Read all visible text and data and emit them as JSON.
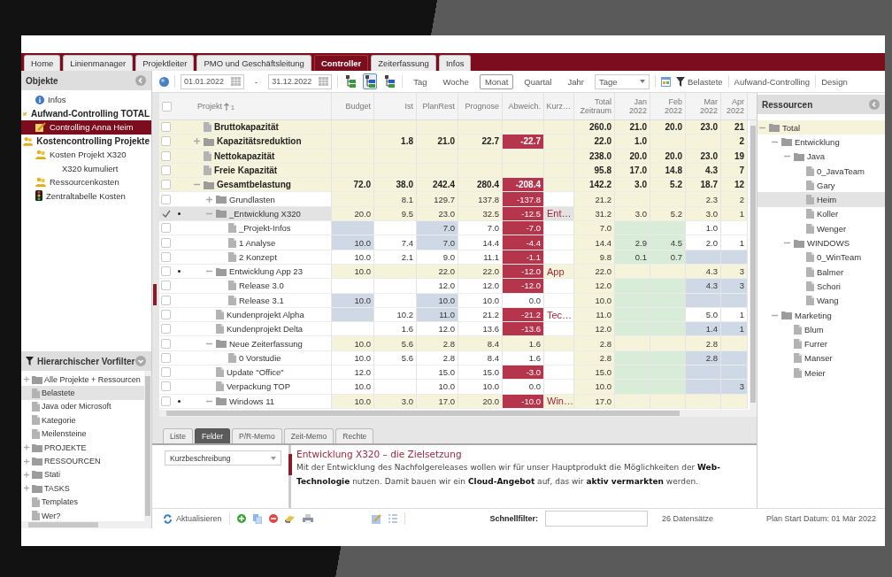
{
  "tabs": [
    {
      "label": "Home",
      "selected": false
    },
    {
      "label": "Linienmanager",
      "selected": false
    },
    {
      "label": "Projektleiter",
      "selected": false
    },
    {
      "label": "PMO und Geschäftsleitung",
      "selected": false
    },
    {
      "label": "Controller",
      "selected": true
    },
    {
      "label": "Zeiterfassung",
      "selected": false
    },
    {
      "label": "Infos",
      "selected": false
    }
  ],
  "objects_panel": {
    "title": "Objekte",
    "items": [
      {
        "label": "Infos",
        "kind": "info",
        "bold": false,
        "selected": false
      },
      {
        "label": "Aufwand-Controlling TOTAL",
        "kind": "note",
        "bold": true,
        "selected": false,
        "children": [
          {
            "label": "Controlling Anna Heim",
            "kind": "note",
            "bold": false,
            "selected": true
          }
        ]
      },
      {
        "label": "Kostencontrolling Projekte",
        "kind": "people",
        "bold": true,
        "selected": false,
        "children": [
          {
            "label": "Kosten Projekt X320",
            "kind": "people",
            "bold": false,
            "selected": false,
            "children": [
              {
                "label": "X320 kumuliert",
                "bold": false,
                "selected": false
              }
            ]
          },
          {
            "label": "Ressourcenkosten",
            "kind": "people",
            "bold": false,
            "selected": false
          },
          {
            "label": "Zentraltabelle Kosten",
            "kind": "traffic",
            "bold": false,
            "selected": false
          }
        ]
      }
    ]
  },
  "prefilter_panel": {
    "title": "Hierarchischer Vorfilter",
    "items": [
      {
        "label": "Alle Projekte + Ressourcen",
        "kind": "folder",
        "expanded": false,
        "selected": false
      },
      {
        "label": "Belastete",
        "kind": "file",
        "selected": true
      },
      {
        "label": "Java oder Microsoft",
        "kind": "file",
        "selected": false
      },
      {
        "label": "Kategorie",
        "kind": "file",
        "selected": false
      },
      {
        "label": "Meilensteine",
        "kind": "file",
        "selected": false
      },
      {
        "label": "PROJEKTE",
        "kind": "folder",
        "expanded": false,
        "selected": false
      },
      {
        "label": "RESSOURCEN",
        "kind": "folder",
        "expanded": false,
        "selected": false
      },
      {
        "label": "Stati",
        "kind": "folder",
        "expanded": false,
        "selected": false
      },
      {
        "label": "TASKS",
        "kind": "folder",
        "expanded": false,
        "selected": false
      },
      {
        "label": "Templates",
        "kind": "file",
        "selected": false
      },
      {
        "label": "Wer?",
        "kind": "file",
        "selected": false
      }
    ]
  },
  "toolbar": {
    "date_from": "01.01.2022",
    "separator": "-",
    "date_to": "31.12.2022",
    "view_buttons": [
      {
        "selected": false
      },
      {
        "selected": true
      },
      {
        "selected": false
      }
    ],
    "periods": [
      {
        "label": "Tag",
        "selected": false
      },
      {
        "label": "Woche",
        "selected": false
      },
      {
        "label": "Monat",
        "selected": true
      },
      {
        "label": "Quartal",
        "selected": false
      },
      {
        "label": "Jahr",
        "selected": false
      }
    ],
    "unit_select": "Tage",
    "filter_label": "Belastete",
    "links": [
      "Aufwand-Controlling",
      "Design"
    ]
  },
  "table": {
    "select_all_checked": false,
    "tree_column": {
      "label": "Projekt",
      "sort_rank": "1"
    },
    "columns": [
      {
        "label": "Budget"
      },
      {
        "label": "Ist"
      },
      {
        "label": "PlanRest"
      },
      {
        "label": "Prognose"
      },
      {
        "label": "Abweich."
      },
      {
        "label": "Kurz…"
      },
      {
        "label": "Total Zeitraum"
      },
      {
        "label": "Jan 2022"
      },
      {
        "label": "Feb 2022"
      },
      {
        "label": "Mar 2022"
      },
      {
        "label": "Apr 2022"
      }
    ],
    "rows": [
      {
        "name": "Bruttokapazität",
        "kind": "file",
        "bold": true,
        "checked": false,
        "marked": false,
        "selected": false,
        "cells": [
          {
            "kind": "total"
          },
          {
            "kind": "total"
          },
          {
            "kind": "total"
          },
          {
            "kind": "total"
          },
          {
            "kind": "total"
          },
          {
            "kind": "total"
          },
          {
            "kind": "total",
            "text": "260.0"
          },
          {
            "kind": "total",
            "text": "21.0"
          },
          {
            "kind": "total",
            "text": "20.0"
          },
          {
            "kind": "total",
            "text": "23.0"
          },
          {
            "kind": "total",
            "text": "21"
          }
        ]
      },
      {
        "name": "Kapazitätsreduktion",
        "kind": "folder",
        "expanded": false,
        "bold": true,
        "checked": false,
        "marked": false,
        "selected": false,
        "cells": [
          {
            "kind": "total"
          },
          {
            "kind": "total",
            "text": "1.8"
          },
          {
            "kind": "total",
            "text": "21.0"
          },
          {
            "kind": "total",
            "text": "22.7"
          },
          {
            "kind": "deviation",
            "text": "-22.7"
          },
          {
            "kind": "total"
          },
          {
            "kind": "total",
            "text": "22.0"
          },
          {
            "kind": "total",
            "text": "1.0"
          },
          {
            "kind": "total"
          },
          {
            "kind": "total"
          },
          {
            "kind": "total",
            "text": "2"
          }
        ]
      },
      {
        "name": "Nettokapazität",
        "kind": "file",
        "bold": true,
        "checked": false,
        "marked": false,
        "selected": false,
        "cells": [
          {
            "kind": "total"
          },
          {
            "kind": "total"
          },
          {
            "kind": "total"
          },
          {
            "kind": "total"
          },
          {
            "kind": "total"
          },
          {
            "kind": "total"
          },
          {
            "kind": "total",
            "text": "238.0"
          },
          {
            "kind": "total",
            "text": "20.0"
          },
          {
            "kind": "total",
            "text": "20.0"
          },
          {
            "kind": "total",
            "text": "23.0"
          },
          {
            "kind": "total",
            "text": "19"
          }
        ]
      },
      {
        "name": "Freie Kapazität",
        "kind": "file",
        "bold": true,
        "checked": false,
        "marked": false,
        "selected": false,
        "cells": [
          {
            "kind": "total"
          },
          {
            "kind": "total"
          },
          {
            "kind": "total"
          },
          {
            "kind": "total"
          },
          {
            "kind": "total"
          },
          {
            "kind": "total"
          },
          {
            "kind": "total",
            "text": "95.8"
          },
          {
            "kind": "total",
            "text": "17.0"
          },
          {
            "kind": "total",
            "text": "14.8"
          },
          {
            "kind": "total",
            "text": "4.3"
          },
          {
            "kind": "total",
            "text": "7"
          }
        ]
      },
      {
        "name": "Gesamtbelastung",
        "kind": "folder",
        "expanded": true,
        "bold": true,
        "checked": false,
        "marked": false,
        "selected": false,
        "cells": [
          {
            "kind": "total",
            "text": "72.0"
          },
          {
            "kind": "total",
            "text": "38.0"
          },
          {
            "kind": "total",
            "text": "242.4"
          },
          {
            "kind": "total",
            "text": "280.4"
          },
          {
            "kind": "deviation",
            "text": "-208.4"
          },
          {
            "kind": "total"
          },
          {
            "kind": "total",
            "text": "142.2"
          },
          {
            "kind": "total",
            "text": "3.0"
          },
          {
            "kind": "total",
            "text": "5.2"
          },
          {
            "kind": "total",
            "text": "18.7"
          },
          {
            "kind": "total",
            "text": "12"
          }
        ],
        "children": [
          {
            "name": "Grundlasten",
            "kind": "folder",
            "expanded": false,
            "bold": false,
            "checked": false,
            "marked": false,
            "selected": false,
            "cells": [
              {
                "kind": "total"
              },
              {
                "kind": "total",
                "text": "8.1"
              },
              {
                "kind": "total",
                "text": "129.7"
              },
              {
                "kind": "total",
                "text": "137.8"
              },
              {
                "kind": "deviation",
                "text": "-137.8"
              },
              {
                "kind": "plain"
              },
              {
                "kind": "total",
                "text": "21.2"
              },
              {
                "kind": "total"
              },
              {
                "kind": "total"
              },
              {
                "kind": "total",
                "text": "2.3"
              },
              {
                "kind": "total",
                "text": "2"
              }
            ]
          },
          {
            "name": "_Entwicklung X320",
            "kind": "folder",
            "expanded": true,
            "bold": false,
            "checked": true,
            "marked": true,
            "selected": true,
            "cells": [
              {
                "kind": "total",
                "text": "20.0"
              },
              {
                "kind": "total",
                "text": "9.5"
              },
              {
                "kind": "total",
                "text": "23.0"
              },
              {
                "kind": "total",
                "text": "32.5"
              },
              {
                "kind": "deviation",
                "text": "-12.5"
              },
              {
                "kind": "current",
                "text": "Ent…"
              },
              {
                "kind": "total",
                "text": "31.2"
              },
              {
                "kind": "total",
                "text": "3.0"
              },
              {
                "kind": "total",
                "text": "5.2"
              },
              {
                "kind": "total",
                "text": "3.0"
              },
              {
                "kind": "total",
                "text": "1"
              }
            ],
            "children": [
              {
                "name": "_Projekt-Infos",
                "kind": "file",
                "bold": false,
                "checked": false,
                "marked": false,
                "selected": false,
                "cells": [
                  {
                    "kind": "plan"
                  },
                  {
                    "kind": "plain"
                  },
                  {
                    "kind": "plan",
                    "text": "7.0"
                  },
                  {
                    "kind": "plain",
                    "text": "7.0"
                  },
                  {
                    "kind": "deviation",
                    "text": "-7.0"
                  },
                  {
                    "kind": "plain"
                  },
                  {
                    "kind": "total",
                    "text": "7.0"
                  },
                  {
                    "kind": "booked"
                  },
                  {
                    "kind": "booked"
                  },
                  {
                    "kind": "plain",
                    "text": "1.0"
                  },
                  {
                    "kind": "plain"
                  }
                ]
              },
              {
                "name": "1 Analyse",
                "kind": "file",
                "bold": false,
                "checked": false,
                "marked": false,
                "selected": false,
                "cells": [
                  {
                    "kind": "plan",
                    "text": "10.0"
                  },
                  {
                    "kind": "plain",
                    "text": "7.4"
                  },
                  {
                    "kind": "plan",
                    "text": "7.0"
                  },
                  {
                    "kind": "plain",
                    "text": "14.4"
                  },
                  {
                    "kind": "deviation",
                    "text": "-4.4"
                  },
                  {
                    "kind": "plain"
                  },
                  {
                    "kind": "total",
                    "text": "14.4"
                  },
                  {
                    "kind": "booked",
                    "text": "2.9"
                  },
                  {
                    "kind": "booked",
                    "text": "4.5"
                  },
                  {
                    "kind": "plain",
                    "text": "2.0"
                  },
                  {
                    "kind": "plain",
                    "text": "1"
                  }
                ]
              },
              {
                "name": "2 Konzept",
                "kind": "file",
                "bold": false,
                "checked": false,
                "marked": false,
                "selected": false,
                "cells": [
                  {
                    "kind": "plain",
                    "text": "10.0"
                  },
                  {
                    "kind": "plain",
                    "text": "2.1"
                  },
                  {
                    "kind": "plain",
                    "text": "9.0"
                  },
                  {
                    "kind": "plain",
                    "text": "11.1"
                  },
                  {
                    "kind": "deviation",
                    "text": "-1.1"
                  },
                  {
                    "kind": "plain"
                  },
                  {
                    "kind": "total",
                    "text": "9.8"
                  },
                  {
                    "kind": "booked",
                    "text": "0.1"
                  },
                  {
                    "kind": "booked",
                    "text": "0.7"
                  },
                  {
                    "kind": "plan"
                  },
                  {
                    "kind": "plan"
                  }
                ]
              }
            ]
          },
          {
            "name": "Entwicklung App 23",
            "kind": "folder",
            "expanded": true,
            "bold": false,
            "checked": false,
            "marked": true,
            "selected": false,
            "cells": [
              {
                "kind": "total",
                "text": "10.0"
              },
              {
                "kind": "total"
              },
              {
                "kind": "total",
                "text": "22.0"
              },
              {
                "kind": "total",
                "text": "22.0"
              },
              {
                "kind": "deviation",
                "text": "-12.0"
              },
              {
                "kind": "total",
                "text": "App"
              },
              {
                "kind": "total",
                "text": "22.0"
              },
              {
                "kind": "total"
              },
              {
                "kind": "total"
              },
              {
                "kind": "total",
                "text": "4.3"
              },
              {
                "kind": "total",
                "text": "3"
              }
            ],
            "children": [
              {
                "name": "Release 3.0",
                "kind": "file",
                "bold": false,
                "checked": false,
                "marked": false,
                "selected": false,
                "cells": [
                  {
                    "kind": "plain"
                  },
                  {
                    "kind": "plain"
                  },
                  {
                    "kind": "plain",
                    "text": "12.0"
                  },
                  {
                    "kind": "plain",
                    "text": "12.0"
                  },
                  {
                    "kind": "deviation",
                    "text": "-12.0"
                  },
                  {
                    "kind": "plain"
                  },
                  {
                    "kind": "total",
                    "text": "12.0"
                  },
                  {
                    "kind": "booked"
                  },
                  {
                    "kind": "booked"
                  },
                  {
                    "kind": "plan",
                    "text": "4.3"
                  },
                  {
                    "kind": "plan",
                    "text": "3"
                  }
                ]
              },
              {
                "name": "Release 3.1",
                "kind": "file",
                "bold": false,
                "checked": false,
                "marked": false,
                "selected": false,
                "cells": [
                  {
                    "kind": "plan",
                    "text": "10.0"
                  },
                  {
                    "kind": "plain"
                  },
                  {
                    "kind": "plan",
                    "text": "10.0"
                  },
                  {
                    "kind": "plain",
                    "text": "10.0"
                  },
                  {
                    "kind": "plain",
                    "text": "0.0"
                  },
                  {
                    "kind": "plain"
                  },
                  {
                    "kind": "total",
                    "text": "10.0"
                  },
                  {
                    "kind": "booked"
                  },
                  {
                    "kind": "booked"
                  },
                  {
                    "kind": "plan"
                  },
                  {
                    "kind": "plan"
                  }
                ]
              }
            ]
          },
          {
            "name": "Kundenprojekt Alpha",
            "kind": "file",
            "bold": false,
            "checked": false,
            "marked": false,
            "selected": false,
            "cells": [
              {
                "kind": "plan"
              },
              {
                "kind": "plain",
                "text": "10.2"
              },
              {
                "kind": "plan",
                "text": "11.0"
              },
              {
                "kind": "plain",
                "text": "21.2"
              },
              {
                "kind": "deviation",
                "text": "-21.2"
              },
              {
                "kind": "plain",
                "text": "Tec…"
              },
              {
                "kind": "total",
                "text": "11.0"
              },
              {
                "kind": "booked"
              },
              {
                "kind": "booked"
              },
              {
                "kind": "plain",
                "text": "5.0"
              },
              {
                "kind": "plain",
                "text": "1"
              }
            ]
          },
          {
            "name": "Kundenprojekt Delta",
            "kind": "file",
            "bold": false,
            "checked": false,
            "marked": false,
            "selected": false,
            "cells": [
              {
                "kind": "plain"
              },
              {
                "kind": "plain",
                "text": "1.6"
              },
              {
                "kind": "plain",
                "text": "12.0"
              },
              {
                "kind": "plain",
                "text": "13.6"
              },
              {
                "kind": "deviation",
                "text": "-13.6"
              },
              {
                "kind": "plain"
              },
              {
                "kind": "total",
                "text": "12.0"
              },
              {
                "kind": "booked"
              },
              {
                "kind": "booked"
              },
              {
                "kind": "plan",
                "text": "1.4"
              },
              {
                "kind": "plan",
                "text": "1"
              }
            ]
          },
          {
            "name": "Neue Zeiterfassung",
            "kind": "folder",
            "expanded": true,
            "bold": false,
            "checked": false,
            "marked": false,
            "selected": false,
            "cells": [
              {
                "kind": "total",
                "text": "10.0"
              },
              {
                "kind": "total",
                "text": "5.6"
              },
              {
                "kind": "total",
                "text": "2.8"
              },
              {
                "kind": "total",
                "text": "8.4"
              },
              {
                "kind": "total",
                "text": "1.6"
              },
              {
                "kind": "total"
              },
              {
                "kind": "total",
                "text": "2.8"
              },
              {
                "kind": "total"
              },
              {
                "kind": "total"
              },
              {
                "kind": "total",
                "text": "2.8"
              },
              {
                "kind": "total"
              }
            ],
            "children": [
              {
                "name": "0 Vorstudie",
                "kind": "file",
                "bold": false,
                "checked": false,
                "marked": false,
                "selected": false,
                "cells": [
                  {
                    "kind": "plain",
                    "text": "10.0"
                  },
                  {
                    "kind": "plain",
                    "text": "5.6"
                  },
                  {
                    "kind": "plain",
                    "text": "2.8"
                  },
                  {
                    "kind": "plain",
                    "text": "8.4"
                  },
                  {
                    "kind": "plain",
                    "text": "1.6"
                  },
                  {
                    "kind": "plain"
                  },
                  {
                    "kind": "total",
                    "text": "2.8"
                  },
                  {
                    "kind": "booked"
                  },
                  {
                    "kind": "booked"
                  },
                  {
                    "kind": "plan",
                    "text": "2.8"
                  },
                  {
                    "kind": "plan"
                  }
                ]
              }
            ]
          },
          {
            "name": "Update \"Office\"",
            "kind": "file",
            "bold": false,
            "checked": false,
            "marked": false,
            "selected": false,
            "cells": [
              {
                "kind": "plain",
                "text": "12.0"
              },
              {
                "kind": "plain"
              },
              {
                "kind": "plain",
                "text": "15.0"
              },
              {
                "kind": "plain",
                "text": "15.0"
              },
              {
                "kind": "deviation",
                "text": "-3.0"
              },
              {
                "kind": "plain"
              },
              {
                "kind": "total",
                "text": "15.0"
              },
              {
                "kind": "booked"
              },
              {
                "kind": "booked"
              },
              {
                "kind": "plan"
              },
              {
                "kind": "plan"
              }
            ]
          },
          {
            "name": "Verpackung TOP",
            "kind": "file",
            "bold": false,
            "checked": false,
            "marked": false,
            "selected": false,
            "cells": [
              {
                "kind": "plain",
                "text": "10.0"
              },
              {
                "kind": "plain"
              },
              {
                "kind": "plain",
                "text": "10.0"
              },
              {
                "kind": "plain",
                "text": "10.0"
              },
              {
                "kind": "plain",
                "text": "0.0"
              },
              {
                "kind": "plain"
              },
              {
                "kind": "total",
                "text": "10.0"
              },
              {
                "kind": "booked"
              },
              {
                "kind": "booked"
              },
              {
                "kind": "plan"
              },
              {
                "kind": "plan",
                "text": "3"
              }
            ]
          },
          {
            "name": "Windows 11",
            "kind": "folder",
            "expanded": true,
            "bold": false,
            "checked": false,
            "marked": true,
            "selected": false,
            "cells": [
              {
                "kind": "total",
                "text": "10.0"
              },
              {
                "kind": "total",
                "text": "3.0"
              },
              {
                "kind": "total",
                "text": "17.0"
              },
              {
                "kind": "total",
                "text": "20.0"
              },
              {
                "kind": "deviation",
                "text": "-10.0"
              },
              {
                "kind": "total",
                "text": "Win…"
              },
              {
                "kind": "total",
                "text": "17.0"
              },
              {
                "kind": "total"
              },
              {
                "kind": "total"
              },
              {
                "kind": "total"
              },
              {
                "kind": "total"
              }
            ]
          }
        ]
      }
    ]
  },
  "detail_tabs": [
    {
      "label": "Liste",
      "selected": false
    },
    {
      "label": "Felder",
      "selected": true
    },
    {
      "label": "P/R-Memo",
      "selected": false
    },
    {
      "label": "Zeit-Memo",
      "selected": false
    },
    {
      "label": "Rechte",
      "selected": false
    }
  ],
  "detail": {
    "field_select": "Kurzbeschreibung",
    "heading": "Entwicklung X320 – die Zielsetzung",
    "text": "Mit der Entwicklung des Nachfolgereleases wollen wir für unser Hauptprodukt die Möglichkeiten der **Web-Technologie** nutzen. Damit bauen wir ein **Cloud-Angebot** auf, das wir **aktiv vermarkten** werden."
  },
  "resources_panel": {
    "title": "Ressourcen",
    "tree": [
      {
        "label": "Total",
        "kind": "folder",
        "expanded": true,
        "selected": false,
        "children": [
          {
            "label": "Entwicklung",
            "kind": "folder",
            "expanded": true,
            "selected": false,
            "children": [
              {
                "label": "Java",
                "kind": "folder",
                "expanded": true,
                "selected": false,
                "children": [
                  {
                    "label": "0_JavaTeam",
                    "kind": "file",
                    "selected": false
                  },
                  {
                    "label": "Gary",
                    "kind": "file",
                    "selected": false
                  },
                  {
                    "label": "Heim",
                    "kind": "file",
                    "selected": true
                  },
                  {
                    "label": "Koller",
                    "kind": "file",
                    "selected": false
                  },
                  {
                    "label": "Wenger",
                    "kind": "file",
                    "selected": false
                  }
                ]
              },
              {
                "label": "WINDOWS",
                "kind": "folder",
                "expanded": true,
                "selected": false,
                "children": [
                  {
                    "label": "0_WinTeam",
                    "kind": "file",
                    "selected": false
                  },
                  {
                    "label": "Balmer",
                    "kind": "file",
                    "selected": false
                  },
                  {
                    "label": "Schori",
                    "kind": "file",
                    "selected": false
                  },
                  {
                    "label": "Wang",
                    "kind": "file",
                    "selected": false
                  }
                ]
              }
            ]
          },
          {
            "label": "Marketing",
            "kind": "folder",
            "expanded": true,
            "selected": false,
            "children": [
              {
                "label": "Blum",
                "kind": "file",
                "selected": false
              },
              {
                "label": "Furrer",
                "kind": "file",
                "selected": false
              },
              {
                "label": "Manser",
                "kind": "file",
                "selected": false
              },
              {
                "label": "Meier",
                "kind": "file",
                "selected": false
              }
            ]
          }
        ]
      }
    ]
  },
  "status_bar": {
    "refresh": "Aktualisieren",
    "quickfilter_label": "Schnellfilter:",
    "record_count": "26 Datensätze",
    "plan_start": "Plan Start Datum: 01 Mär 2022"
  }
}
